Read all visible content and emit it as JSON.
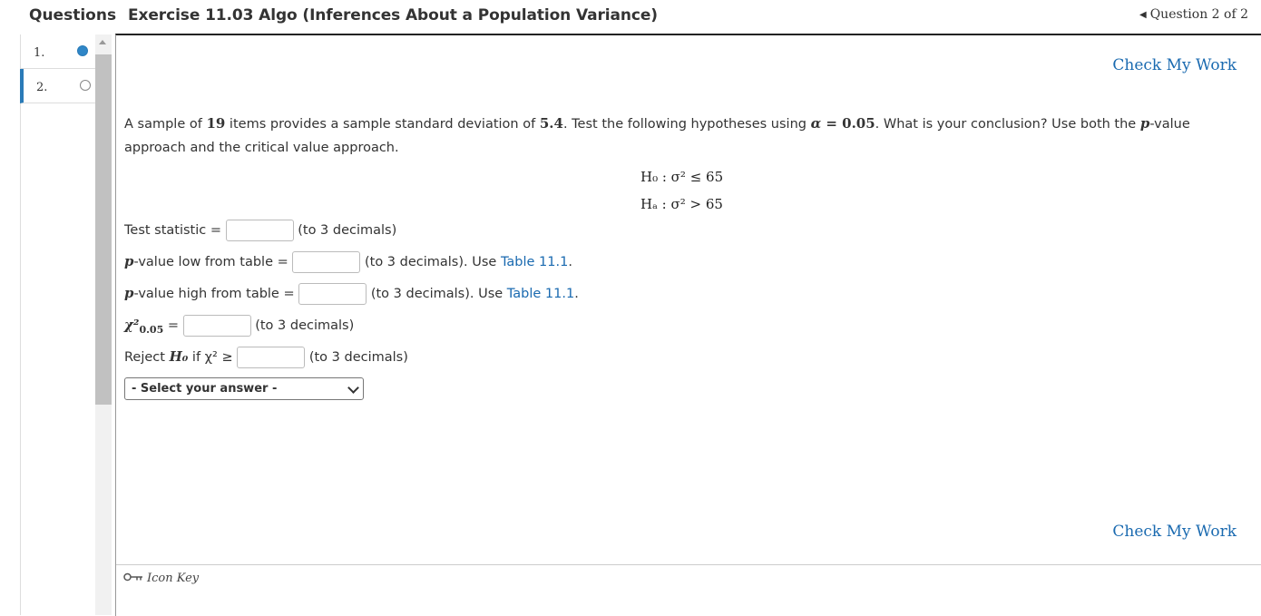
{
  "header": {
    "questions_label": "Questions",
    "title": "Exercise 11.03 Algo (Inferences About a Population Variance)",
    "question_nav": "Question 2 of 2"
  },
  "question_list": [
    {
      "number": "1.",
      "status": "answered"
    },
    {
      "number": "2.",
      "status": "current"
    }
  ],
  "check_my_work": "Check My Work",
  "problem": {
    "s1": "A sample of ",
    "n": "19",
    "s2": " items provides a sample standard deviation of ",
    "sd": "5.4",
    "s3": ". Test the following hypotheses using ",
    "alpha_sym": "α",
    "alpha_eq": " = 0.05",
    "s4": ". What is your conclusion? Use both the ",
    "p": "p",
    "s5": "-value approach and the critical value approach."
  },
  "hypotheses": {
    "h0": "H₀ : σ² ≤ 65",
    "ha": "Hₐ : σ² > 65"
  },
  "fields": {
    "test_stat_label": "Test statistic =",
    "to3": "(to 3 decimals)",
    "p": "p",
    "p_low_label": "-value low from table =",
    "p_high_label": "-value high from table =",
    "to3_use": "(to 3 decimals). Use ",
    "table_link": "Table 11.1",
    "period": ".",
    "chi_label": "χ²",
    "chi_sub": "0.05",
    "eq": "=",
    "reject_label": "Reject ",
    "reject_h0": "H₀",
    "reject_if": " if χ² ≥"
  },
  "select": {
    "value": "- Select your answer -"
  },
  "icon_key": "Icon Key",
  "colors": {
    "link": "#1a6ab0",
    "answered_dot": "#2f86c7",
    "current_marker": "#2a7bb8"
  }
}
